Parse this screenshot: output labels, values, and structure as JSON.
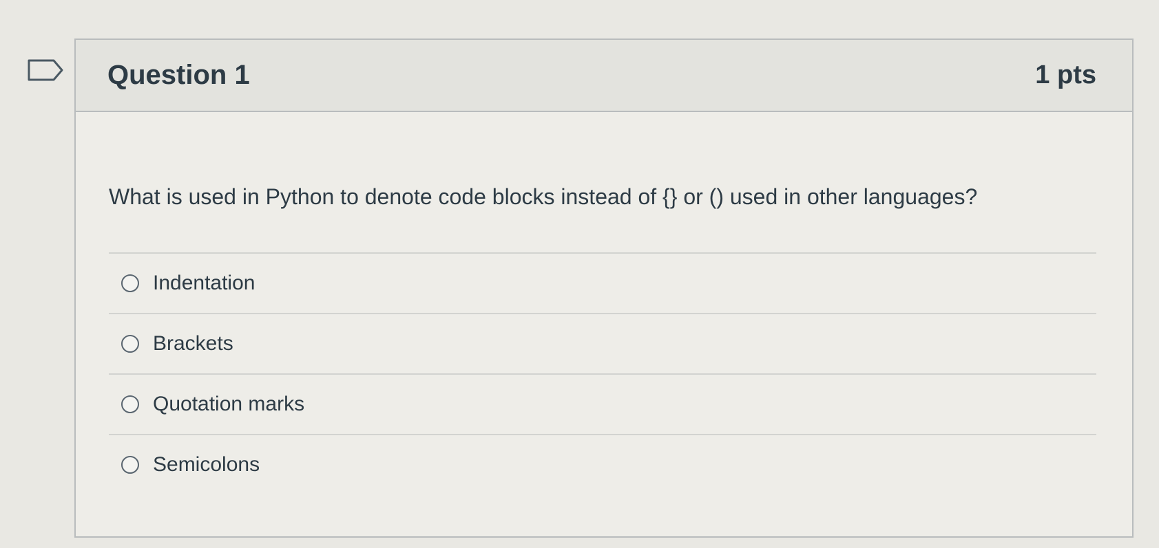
{
  "question": {
    "title": "Question 1",
    "points": "1 pts",
    "text": "What is used in Python to denote code blocks instead of {} or () used in other languages?",
    "answers": [
      {
        "label": "Indentation",
        "selected": false
      },
      {
        "label": "Brackets",
        "selected": false
      },
      {
        "label": "Quotation marks",
        "selected": false
      },
      {
        "label": "Semicolons",
        "selected": false
      }
    ]
  },
  "icons": {
    "flag": "flag-question-icon"
  },
  "colors": {
    "text": "#2d3b45",
    "header_bg": "#e3e3de",
    "border": "#b9bcbd"
  }
}
